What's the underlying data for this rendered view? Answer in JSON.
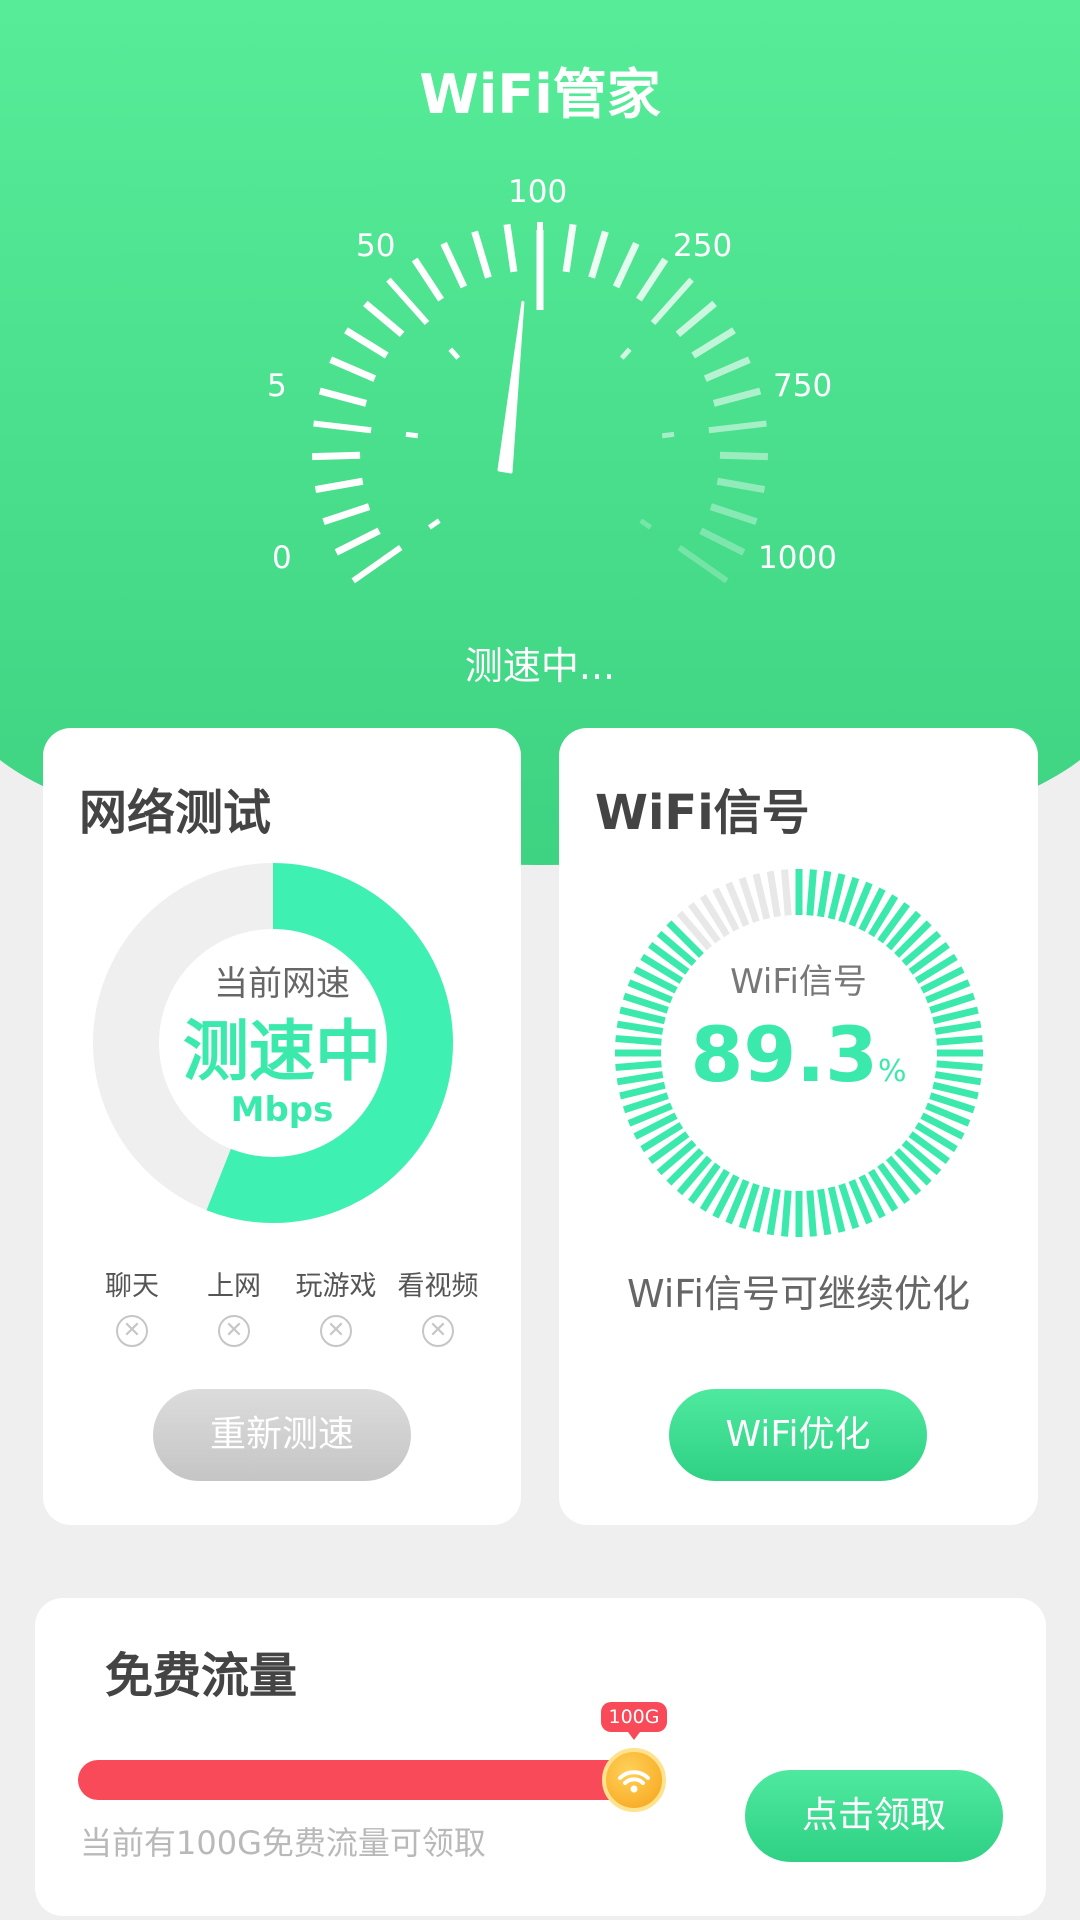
{
  "header": {
    "title": "WiFi管家"
  },
  "speedometer": {
    "scale_labels": [
      "0",
      "5",
      "50",
      "100",
      "250",
      "750",
      "1000"
    ],
    "needle_reading": 100,
    "status": "测速中..."
  },
  "network_card": {
    "title": "网络测试",
    "ring": {
      "label": "当前网速",
      "value": "测速中",
      "unit": "Mbps",
      "progress_percent": 56
    },
    "apps": [
      {
        "name": "聊天",
        "status_icon": "x-circle-icon"
      },
      {
        "name": "上网",
        "status_icon": "x-circle-icon"
      },
      {
        "name": "玩游戏",
        "status_icon": "x-circle-icon"
      },
      {
        "name": "看视频",
        "status_icon": "x-circle-icon"
      }
    ],
    "retest_label": "重新测速"
  },
  "signal_card": {
    "title": "WiFi信号",
    "ring_label": "WiFi信号",
    "value": "89.3",
    "unit": "%",
    "hint": "WiFi信号可继续优化",
    "optimize_label": "WiFi优化"
  },
  "traffic_card": {
    "title": "免费流量",
    "badge": "100G",
    "description": "当前有100G免费流量可领取",
    "claim_label": "点击领取"
  },
  "colors": {
    "green": "#3bd180",
    "accent": "#3ce9ad",
    "red": "#f84a58",
    "gray_button": "#c5c5c5",
    "knob_orange": "#f6a319"
  }
}
